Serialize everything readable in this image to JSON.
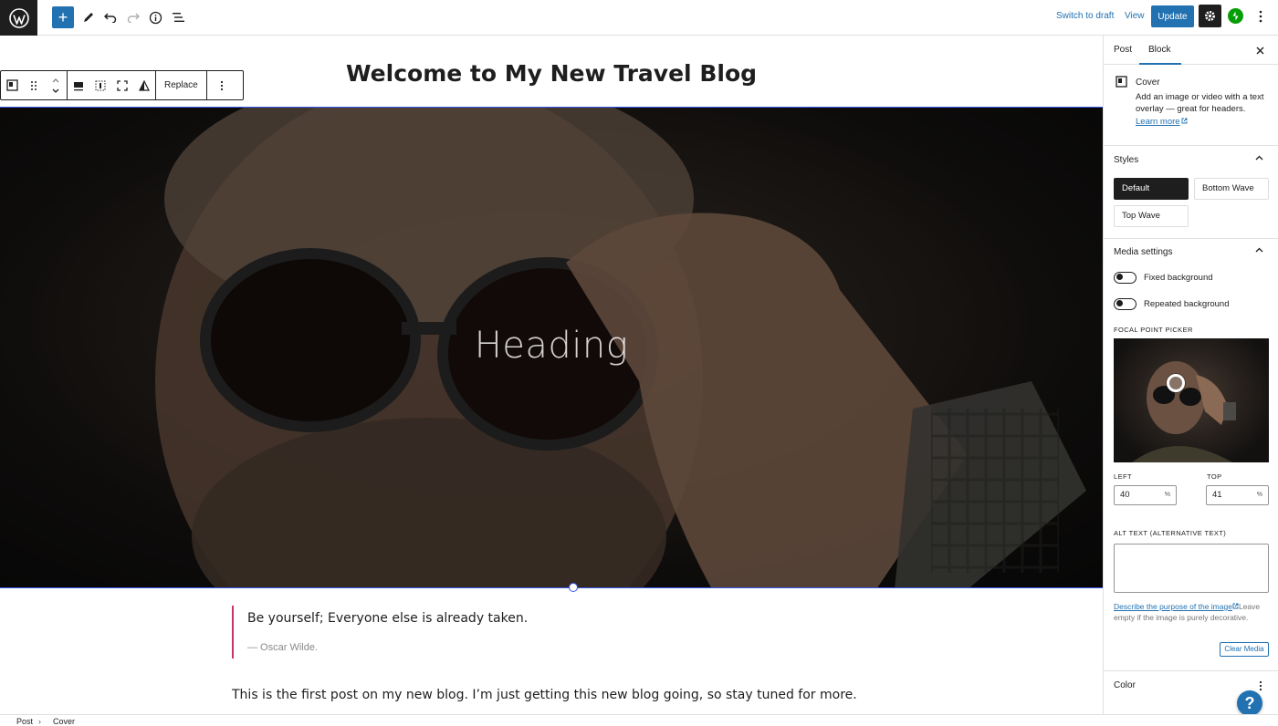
{
  "topbar": {
    "switch_to_draft": "Switch to draft",
    "view": "View",
    "update": "Update",
    "add_block_icon": "plus-icon",
    "colors": {
      "accent": "#2271b1",
      "dark": "#1e1e1e",
      "jetpack": "#069e08"
    }
  },
  "editor": {
    "post_title": "Welcome to My New Travel Blog",
    "toolbar": {
      "replace_label": "Replace"
    },
    "cover": {
      "heading": "Heading"
    },
    "quote": {
      "text": "Be  yourself; Everyone else is already taken.",
      "citation": "— Oscar Wilde."
    },
    "paragraph": "This is the first post on my new blog. I’m just getting this new blog going, so stay tuned for more."
  },
  "sidebar": {
    "tabs": {
      "post": "Post",
      "block": "Block"
    },
    "block_card": {
      "name": "Cover",
      "description": "Add an image or video with a text overlay — great for headers.",
      "learn_more": "Learn more"
    },
    "styles": {
      "title": "Styles",
      "options": {
        "default": "Default",
        "bottom_wave": "Bottom Wave",
        "top_wave": "Top Wave"
      },
      "selected": "Default"
    },
    "media_settings": {
      "title": "Media settings",
      "fixed_background": "Fixed background",
      "fixed_background_on": false,
      "repeated_background": "Repeated background",
      "repeated_background_on": false,
      "focal_point_label": "FOCAL POINT PICKER",
      "left_label": "LEFT",
      "left_value": "40",
      "top_label": "TOP",
      "top_value": "41",
      "unit": "%",
      "alt_label": "ALT TEXT (ALTERNATIVE TEXT)",
      "alt_value": "",
      "alt_help_link": "Describe the purpose of the image",
      "alt_help_rest": "Leave empty if the image is purely decorative.",
      "clear_media": "Clear Media"
    },
    "color": {
      "title": "Color"
    }
  },
  "help_button": "?",
  "breadcrumb": {
    "items": [
      "Post",
      "Cover"
    ],
    "separator": "›"
  }
}
